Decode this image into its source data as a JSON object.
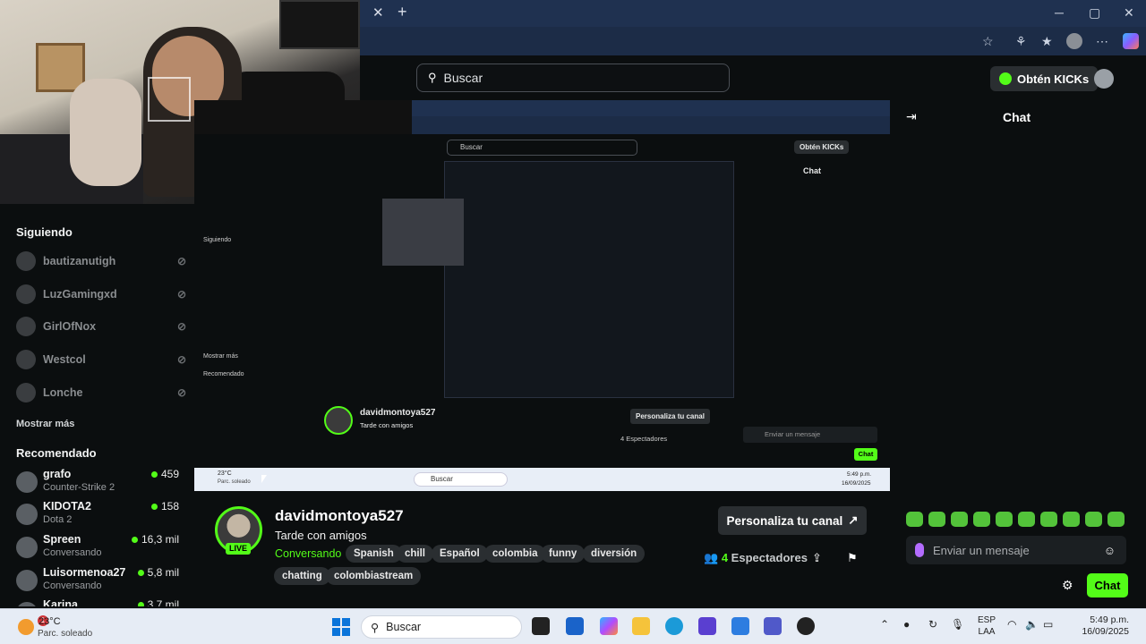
{
  "browser": {
    "tab_close": "✕",
    "tab_new": "+",
    "window": {
      "minimize": "─",
      "maximize": "▢",
      "close": "✕"
    }
  },
  "header": {
    "search_placeholder": "Buscar",
    "kicks_label": "Obtén KICKs"
  },
  "sidebar": {
    "following_title": "Siguiendo",
    "following": [
      {
        "name": "bautizanutigh"
      },
      {
        "name": "LuzGamingxd"
      },
      {
        "name": "GirlOfNox"
      },
      {
        "name": "Westcol"
      },
      {
        "name": "Lonche"
      }
    ],
    "show_more": "Mostrar más",
    "recommended_title": "Recomendado",
    "recommended": [
      {
        "name": "grafo",
        "category": "Counter-Strike 2",
        "viewers": "459"
      },
      {
        "name": "KIDOTA2",
        "category": "Dota 2",
        "viewers": "158"
      },
      {
        "name": "Spreen",
        "category": "Conversando",
        "viewers": "16,3 mil"
      },
      {
        "name": "Luisormenoa27",
        "category": "Conversando",
        "viewers": "5,8 mil"
      },
      {
        "name": "Karina",
        "category": "",
        "viewers": "3,7 mil"
      }
    ]
  },
  "chat": {
    "title": "Chat",
    "message_placeholder": "Enviar un mensaje",
    "send_label": "Chat",
    "emote_count": 10
  },
  "channel": {
    "name": "davidmontoya527",
    "live_badge": "LIVE",
    "title": "Tarde con amigos",
    "category": "Conversando",
    "tags": [
      "Spanish",
      "chill",
      "Español",
      "colombia",
      "funny",
      "diversión",
      "chatting",
      "colombiastream"
    ],
    "customize_label": "Personaliza tu canal",
    "viewers_count": "4",
    "viewers_label": "Espectadores"
  },
  "stream_preview": {
    "search": "Buscar",
    "kicks": "Obtén KICKs",
    "chat": "Chat",
    "following": "Siguiendo",
    "show_more": "Mostrar más",
    "recommended": "Recomendado",
    "channel_name": "davidmontoya527",
    "channel_title": "Tarde con amigos",
    "customize": "Personaliza tu canal",
    "viewers": "4 Espectadores",
    "message": "Enviar un mensaje",
    "taskbar_search": "Buscar",
    "weather_temp": "23°C",
    "weather_desc": "Parc. soleado",
    "clock_time": "5:49 p.m.",
    "clock_date": "16/09/2025",
    "send": "Chat"
  },
  "taskbar": {
    "temperature": "23°C",
    "weather": "Parc. soleado",
    "notification_count": "1",
    "search_placeholder": "Buscar",
    "lang_top": "ESP",
    "lang_bottom": "LAA",
    "time": "5:49 p.m.",
    "date": "16/09/2025"
  }
}
